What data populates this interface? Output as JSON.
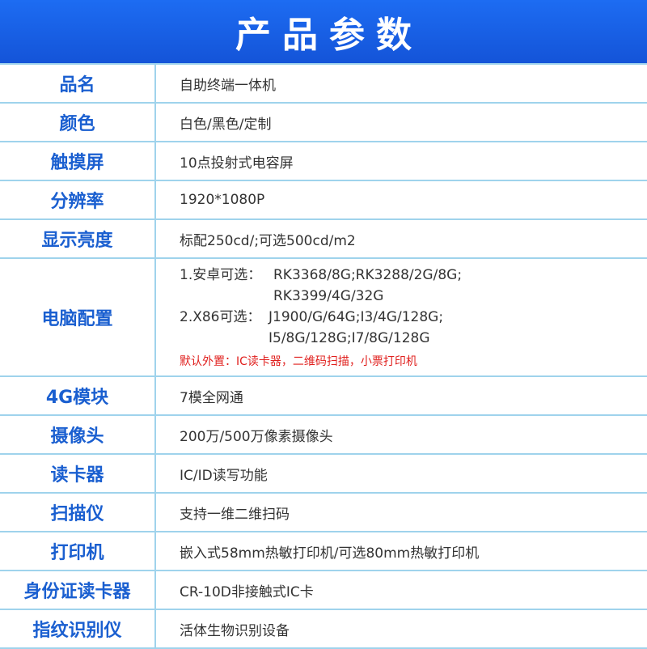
{
  "title": "产品参数",
  "rows": [
    {
      "label": "品名",
      "value": "自助终端一体机"
    },
    {
      "label": "颜色",
      "value": "白色/黑色/定制"
    },
    {
      "label": "触摸屏",
      "value": "10点投射式电容屏"
    },
    {
      "label": "分辨率",
      "value": "1920*1080P"
    },
    {
      "label": "显示亮度",
      "value": "标配250cd/;可选500cd/m2"
    },
    {
      "label": "电脑配置",
      "android_prefix": "1.安卓可选：",
      "android_line1": "RK3368/8G;RK3288/2G/8G;",
      "android_line2": "RK3399/4G/32G",
      "x86_prefix": "2.X86可选：",
      "x86_line1": "J1900/G/64G;I3/4G/128G;",
      "x86_line2": "I5/8G/128G;I7/8G/128G",
      "note": "默认外置：IC读卡器，二维码扫描，小票打印机"
    },
    {
      "label": "4G模块",
      "value": "7模全网通"
    },
    {
      "label": "摄像头",
      "value": "200万/500万像素摄像头"
    },
    {
      "label": "读卡器",
      "value": "IC/ID读写功能"
    },
    {
      "label": "扫描仪",
      "value": "支持一维二维扫码"
    },
    {
      "label": "打印机",
      "value": "嵌入式58mm热敏打印机/可选80mm热敏打印机"
    },
    {
      "label": "身份证读卡器",
      "value": "CR-10D非接触式IC卡"
    },
    {
      "label": "指纹识别仪",
      "value": "活体生物识别设备"
    }
  ],
  "colors": {
    "banner": "#1d6cf2",
    "label": "#1a5fd0",
    "border": "#9fd3ec",
    "note": "#e0201e"
  }
}
